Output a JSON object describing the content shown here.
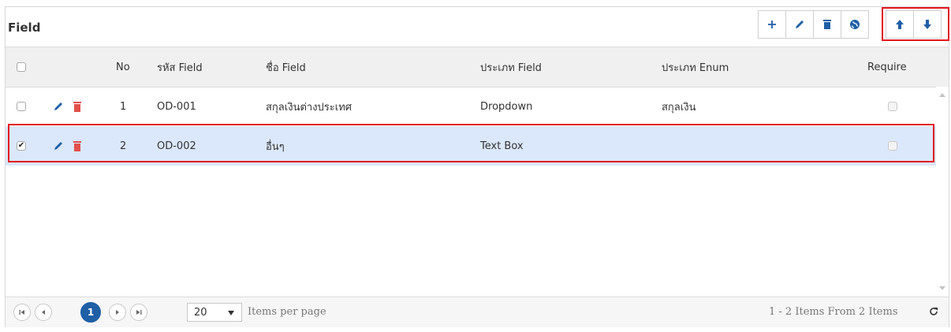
{
  "panel": {
    "title": "Field"
  },
  "toolbar": {
    "add_icon": "plus-icon",
    "edit_icon": "pencil-icon",
    "delete_icon": "trash-icon",
    "language_icon": "globe-icon",
    "move_up_icon": "arrow-up-icon",
    "move_down_icon": "arrow-down-icon",
    "primary_color": "#1f5fa6",
    "highlight_color": "#e3161c"
  },
  "grid": {
    "columns": {
      "no": "No",
      "code": "รหัส Field",
      "name": "ชื่อ Field",
      "type": "ประเภท Field",
      "enum_type": "ประเภท Enum",
      "require": "Require"
    },
    "rows": [
      {
        "no": "1",
        "code": "OD-001",
        "name": "สกุลเงินต่างประเทศ",
        "type": "Dropdown",
        "enum_type": "สกุลเงิน",
        "checked": "",
        "require": ""
      },
      {
        "no": "2",
        "code": "OD-002",
        "name": "อื่นๆ",
        "type": "Text Box",
        "enum_type": "",
        "checked": "✔",
        "require": ""
      }
    ],
    "selected_row_color": "#dbe7fb"
  },
  "pager": {
    "current_page": "1",
    "page_size": "20",
    "per_page_label": "Items per page",
    "summary": "1 - 2 Items From 2 Items",
    "refresh_icon": "refresh-icon"
  }
}
